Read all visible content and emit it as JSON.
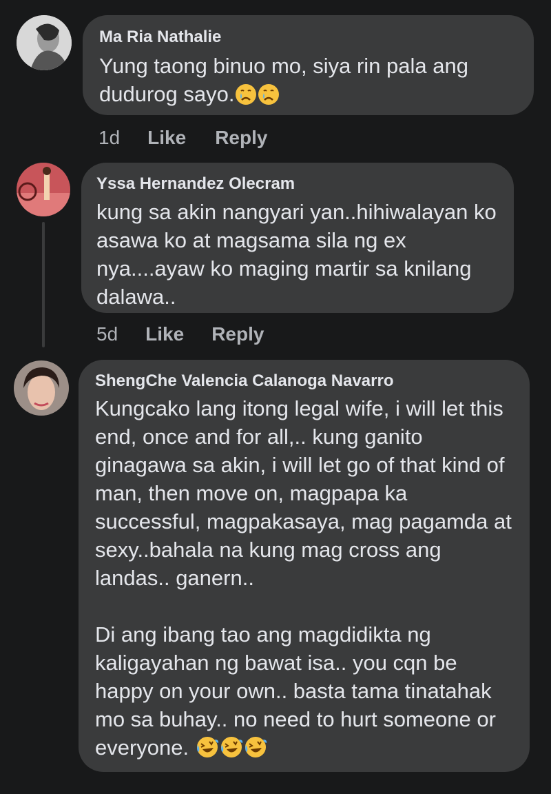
{
  "comments": [
    {
      "author": "Ma Ria Nathalie",
      "text": "Yung taong binuo mo, siya  rin pala ang dudurog sayo.",
      "emojis": [
        "crying-face-icon",
        "crying-face-icon"
      ],
      "time": "1d",
      "like_label": "Like",
      "reply_label": "Reply"
    },
    {
      "author": "Yssa Hernandez Olecram",
      "text": "kung sa akin nangyari yan..hihiwalayan ko asawa ko at magsama sila ng ex nya....ayaw ko maging martir sa knilang dalawa..",
      "time": "5d",
      "like_label": "Like",
      "reply_label": "Reply"
    },
    {
      "author": "ShengChe Valencia Calanoga Navarro",
      "paragraph1": "Kungcako lang itong legal wife, i will let this end, once and for all,.. kung ganito ginagawa sa akin, i will let go of that kind of man, then move on, magpapa ka successful, magpakasaya, mag pagamda at sexy..bahala na kung mag cross ang landas.. ganern..",
      "paragraph2": "Di ang ibang tao ang magdidikta ng kaligayahan ng bawat isa.. you cqn be happy on your own.. basta tama tinatahak mo sa buhay.. no need to hurt someone or everyone.",
      "emojis": [
        "laughing-tears-icon",
        "laughing-tears-icon",
        "laughing-tears-icon"
      ]
    }
  ]
}
